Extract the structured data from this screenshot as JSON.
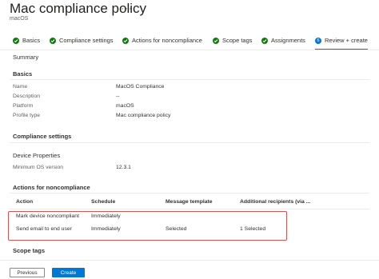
{
  "header": {
    "title": "Mac compliance policy",
    "more": "···",
    "subtitle": "macOS"
  },
  "steps": [
    {
      "label": "Basics"
    },
    {
      "label": "Compliance settings"
    },
    {
      "label": "Actions for noncompliance"
    },
    {
      "label": "Scope tags"
    },
    {
      "label": "Assignments"
    },
    {
      "label": "Review + create",
      "number": "6"
    }
  ],
  "summary": {
    "heading": "Summary"
  },
  "basics": {
    "heading": "Basics",
    "rows": [
      {
        "label": "Name",
        "value": "MacOS Compliance"
      },
      {
        "label": "Description",
        "value": "--"
      },
      {
        "label": "Platform",
        "value": "macOS"
      },
      {
        "label": "Profile type",
        "value": "Mac compliance policy"
      }
    ]
  },
  "compliance": {
    "heading": "Compliance settings",
    "group": "Device Properties",
    "rows": [
      {
        "label": "Minimum OS version",
        "value": "12.3.1"
      }
    ]
  },
  "actions": {
    "heading": "Actions for noncompliance",
    "columns": [
      "Action",
      "Schedule",
      "Message template",
      "Additional recipients (via ..."
    ],
    "rows": [
      [
        "Mark device noncompliant",
        "Immediately",
        "",
        ""
      ],
      [
        "Send email to end user",
        "Immediately",
        "Selected",
        "1 Selected"
      ]
    ]
  },
  "scope": {
    "heading": "Scope tags"
  },
  "footer": {
    "previous": "Previous",
    "create": "Create"
  },
  "colors": {
    "accent": "#0078d4",
    "success": "#107c10",
    "highlight": "#d9534f"
  }
}
